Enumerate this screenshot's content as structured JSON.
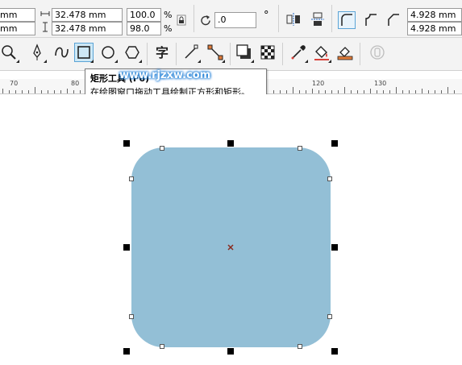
{
  "property_bar": {
    "x_value": "mm",
    "y_value": "mm",
    "width_value": "32.478 mm",
    "height_value": "32.478 mm",
    "scale_x": "100.0",
    "scale_y": "98.0",
    "percent": "%",
    "rotation": ".0",
    "degree": "°",
    "corner_radius_top": "4.928 mm",
    "corner_radius_bottom": "4.928 mm"
  },
  "ruler": {
    "labels": [
      "70",
      "80",
      "120",
      "130"
    ]
  },
  "tooltip": {
    "title": "矩形工具 (F6)",
    "description": "在绘图窗口拖动工具绘制正方形和矩形。"
  },
  "watermark": "www.rjzxw.com",
  "colors": {
    "rectangle_fill": "#93bfd6",
    "active_tool": "#cde8f6"
  },
  "icons": [
    "lock-icon",
    "rotate-icon",
    "mirror-horizontal-icon",
    "mirror-vertical-icon",
    "round-corner-icon",
    "scallop-corner-icon",
    "chamfer-corner-icon",
    "zoom-icon",
    "pen-icon",
    "curve-icon",
    "rectangle-icon",
    "ellipse-icon",
    "polygon-icon",
    "text-icon",
    "line-icon",
    "connector-icon",
    "shadow-icon",
    "transparency-icon",
    "eyedropper-icon",
    "fill-icon",
    "smart-fill-icon",
    "lens-icon"
  ]
}
